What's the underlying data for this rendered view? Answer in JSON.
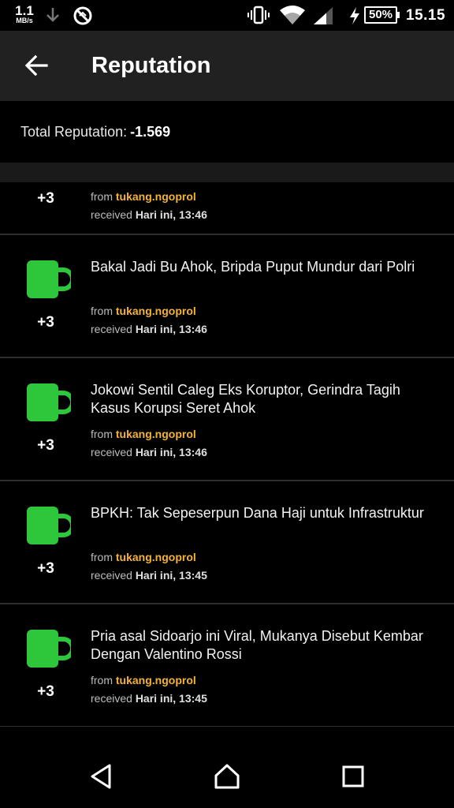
{
  "status_bar": {
    "speed_value": "1.1",
    "speed_unit": "MB/s",
    "battery": "50%",
    "time": "15.15",
    "icons": [
      "download-icon",
      "no-sync-icon",
      "vibrate-icon",
      "wifi-icon",
      "signal-icon",
      "charging-icon"
    ]
  },
  "app_bar": {
    "title": "Reputation",
    "back_icon": "back-arrow-icon"
  },
  "total": {
    "label": "Total Reputation:",
    "value": "-1.569"
  },
  "items": [
    {
      "title": "",
      "points": "+3",
      "from_label": "from",
      "user": "tukang.ngoprol",
      "received_label": "received",
      "when": "Hari ini, 13:46",
      "icon": "mug-icon"
    },
    {
      "title": "Bakal Jadi Bu Ahok, Bripda Puput Mundur dari Polri",
      "points": "+3",
      "from_label": "from",
      "user": "tukang.ngoprol",
      "received_label": "received",
      "when": "Hari ini, 13:46",
      "icon": "mug-icon"
    },
    {
      "title": "Jokowi Sentil Caleg Eks Koruptor, Gerindra Tagih Kasus Korupsi Seret Ahok",
      "points": "+3",
      "from_label": "from",
      "user": "tukang.ngoprol",
      "received_label": "received",
      "when": "Hari ini, 13:46",
      "icon": "mug-icon"
    },
    {
      "title": "BPKH: Tak Sepeserpun Dana Haji untuk Infrastruktur",
      "points": "+3",
      "from_label": "from",
      "user": "tukang.ngoprol",
      "received_label": "received",
      "when": "Hari ini, 13:45",
      "icon": "mug-icon"
    },
    {
      "title": "Pria asal Sidoarjo ini Viral, Mukanya Disebut Kembar Dengan Valentino Rossi",
      "points": "+3",
      "from_label": "from",
      "user": "tukang.ngoprol",
      "received_label": "received",
      "when": "Hari ini, 13:45",
      "icon": "mug-icon"
    }
  ],
  "nav_bar": {
    "icons": [
      "back-triangle-icon",
      "home-icon",
      "recents-icon"
    ]
  },
  "colors": {
    "mug": "#2ec73c",
    "username": "#f5b335",
    "app_bar": "#212121"
  }
}
